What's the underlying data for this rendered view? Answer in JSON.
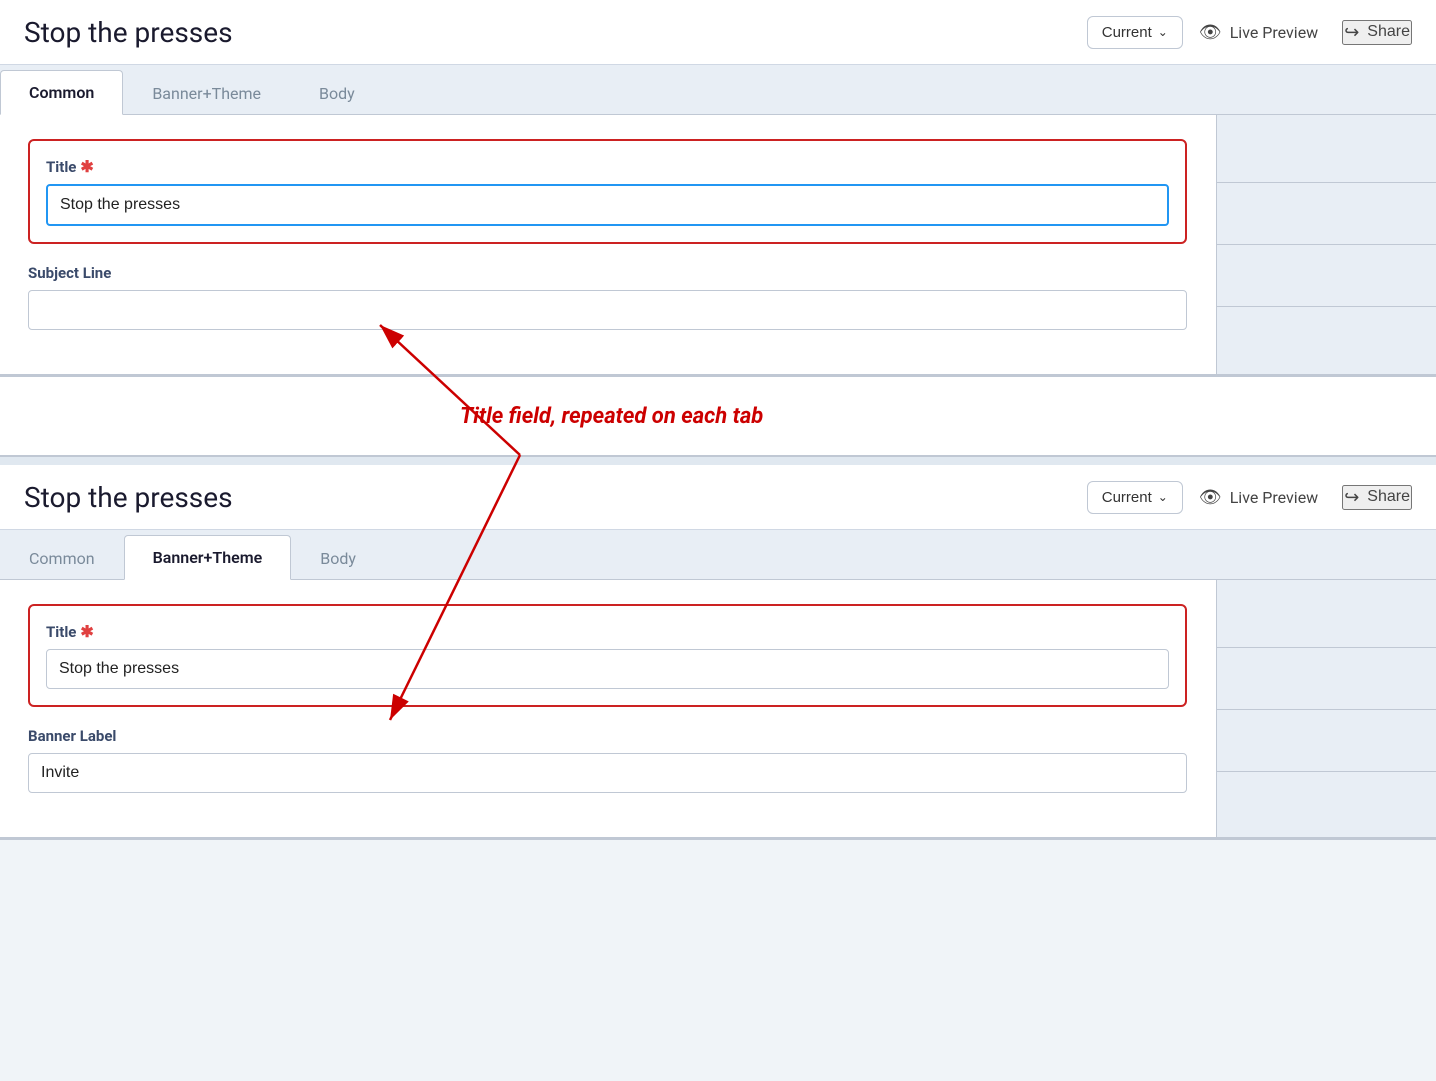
{
  "page": {
    "title": "Stop the presses"
  },
  "header": {
    "title": "Stop the presses",
    "dropdown_label": "Current",
    "live_preview_label": "Live Preview",
    "share_label": "Share"
  },
  "tabs": {
    "items": [
      {
        "id": "common",
        "label": "Common"
      },
      {
        "id": "banner-theme",
        "label": "Banner+Theme"
      },
      {
        "id": "body",
        "label": "Body"
      }
    ]
  },
  "panel1": {
    "active_tab": "Common",
    "title_label": "Title",
    "title_value": "Stop the presses",
    "subject_line_label": "Subject Line",
    "subject_line_value": ""
  },
  "panel2": {
    "active_tab": "Banner+Theme",
    "title_label": "Title",
    "title_value": "Stop the presses",
    "banner_label_label": "Banner Label",
    "banner_label_value": "Invite"
  },
  "annotation": {
    "text": "Title field, repeated on each tab"
  },
  "icons": {
    "eye": "👁",
    "share": "↪",
    "chevron_down": "∨"
  }
}
